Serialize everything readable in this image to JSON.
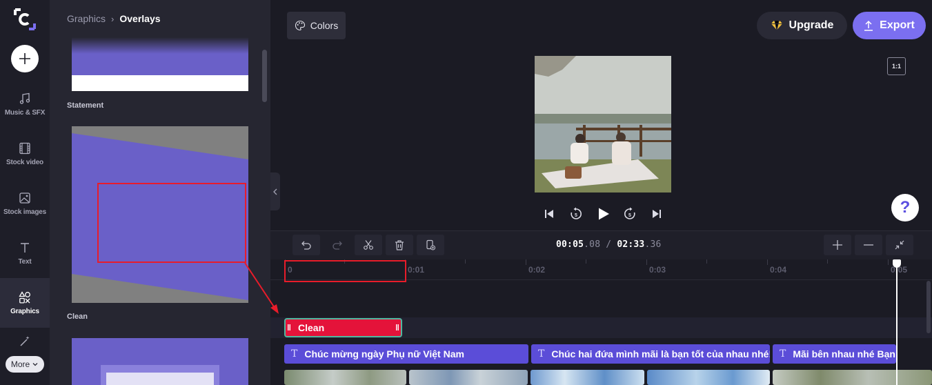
{
  "rail": {
    "items": [
      {
        "label": "Music & SFX",
        "icon": "music-note-icon"
      },
      {
        "label": "Stock video",
        "icon": "film-icon"
      },
      {
        "label": "Stock images",
        "icon": "image-icon"
      },
      {
        "label": "Text",
        "icon": "text-icon"
      },
      {
        "label": "Graphics",
        "icon": "shapes-icon",
        "active": true
      },
      {
        "label": "",
        "icon": "magic-wand-icon"
      }
    ],
    "more_label": "More"
  },
  "panel": {
    "breadcrumb_parent": "Graphics",
    "breadcrumb_current": "Overlays",
    "thumbnails": [
      {
        "label": "Statement"
      },
      {
        "label": "Clean"
      }
    ]
  },
  "header": {
    "colors_label": "Colors",
    "upgrade_label": "Upgrade",
    "export_label": "Export",
    "ratio_label": "1:1"
  },
  "help_label": "?",
  "timeline": {
    "time_current_main": "00:05",
    "time_current_frac": ".08",
    "time_sep": " / ",
    "time_total_main": "02:33",
    "time_total_frac": ".36",
    "ruler_labels": [
      "0",
      "0:01",
      "0:02",
      "0:03",
      "0:04",
      "0:05"
    ],
    "overlay_clip_label": "Clean",
    "text_clips": [
      "Chúc mừng ngày Phụ nữ Việt Nam",
      "Chúc hai đứa mình mãi là bạn tốt của nhau nhé!",
      "Mãi bên nhau nhé Bạn t"
    ]
  },
  "colors": {
    "accent": "#7b6ff0",
    "overlay_clip": "#e4133a",
    "text_clip": "#5b4dd8",
    "annotation": "#e81c2a"
  }
}
